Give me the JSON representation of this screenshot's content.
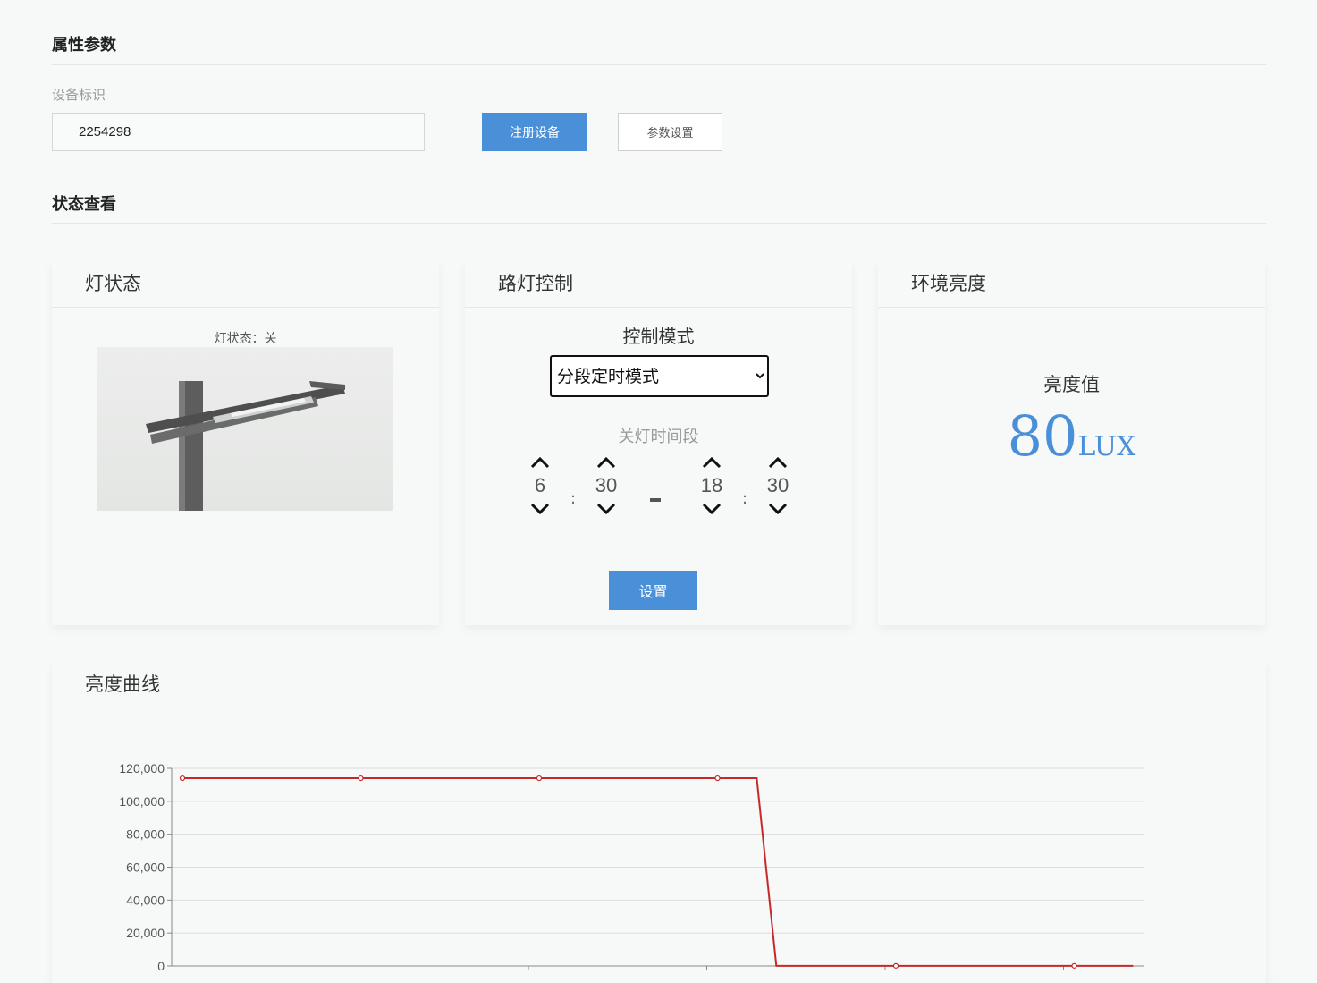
{
  "attributes": {
    "title": "属性参数",
    "device_id_label": "设备标识",
    "device_id_value": "2254298",
    "register_button": "注册设备",
    "params_button": "参数设置"
  },
  "status": {
    "title": "状态查看"
  },
  "lamp_card": {
    "title": "灯状态",
    "status_text": "灯状态：关"
  },
  "control_card": {
    "title": "路灯控制",
    "mode_label": "控制模式",
    "mode_selected": "分段定时模式",
    "period_label": "关灯时间段",
    "start_hour": "6",
    "start_minute": "30",
    "end_hour": "18",
    "end_minute": "30",
    "separator": ":",
    "set_button": "设置"
  },
  "env_card": {
    "title": "环境亮度",
    "label": "亮度值",
    "value": "80",
    "unit": "LUX"
  },
  "curve_card": {
    "title": "亮度曲线"
  },
  "colors": {
    "accent": "#4a90d9",
    "line": "#c62828"
  },
  "chart_data": {
    "type": "line",
    "title": "",
    "xlabel": "",
    "ylabel": "",
    "ylim": [
      0,
      120000
    ],
    "y_ticks": [
      "0",
      "20,000",
      "40,000",
      "60,000",
      "80,000",
      "100,000",
      "120,000"
    ],
    "x_index_range": [
      0,
      5.4
    ],
    "grid": true,
    "series": [
      {
        "x": [
          0,
          1,
          2,
          3,
          3.22,
          3.33,
          4,
          5,
          5.33
        ],
        "values": [
          114000,
          114000,
          114000,
          114000,
          114000,
          80,
          80,
          80,
          80
        ],
        "markers": [
          true,
          true,
          true,
          true,
          false,
          false,
          true,
          true,
          false
        ]
      }
    ]
  }
}
